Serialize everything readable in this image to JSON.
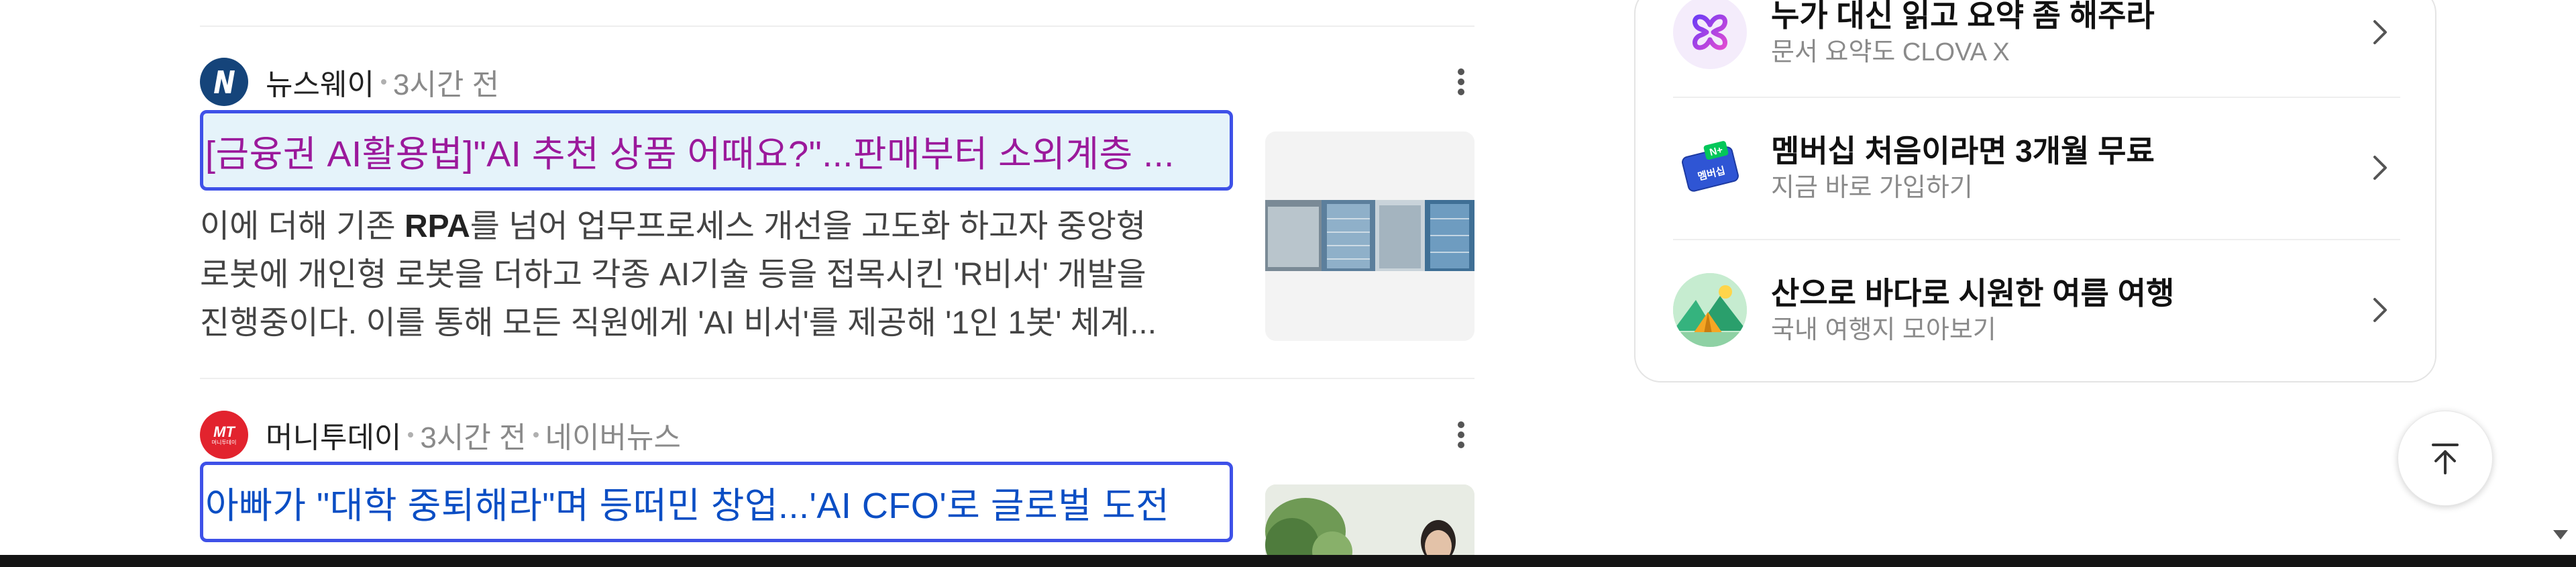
{
  "news": [
    {
      "source": "뉴스웨이",
      "time": "3시간 전",
      "extra": "",
      "headline": "[금융권 AI활용법]\"AI 추천 상품 어때요?\"...판매부터 소외계층 ...",
      "snippet_lines": [
        "이에 더해 기존 RPA를 넘어 업무프로세스 개선을 고도화 하고자 중앙형",
        "로봇에 개인형 로봇을 더하고 각종 AI기술 등을 접목시킨 'R비서' 개발을",
        "진행중이다. 이를 통해 모든 직원에게 'AI 비서'를 제공해 '1인 1봇' 체계..."
      ],
      "bold_word": "RPA"
    },
    {
      "source": "머니투데이",
      "time": "3시간 전",
      "extra": "네이버뉴스",
      "headline": "아빠가 \"대학 중퇴해라\"며 등떠민 창업...'AI CFO'로 글로벌 도전",
      "logo_text": "MT",
      "logo_subtext": "머니투데이"
    }
  ],
  "panel": {
    "items": [
      {
        "title": "누가 대신 읽고 요약 좀 해주라",
        "subtitle": "문서 요약도 CLOVA X",
        "icon": "clova-x-icon"
      },
      {
        "title": "멤버십 처음이라면 3개월 무료",
        "subtitle": "지금 바로 가입하기",
        "icon": "membership-icon",
        "icon_text_top": "N+",
        "icon_text": "멤버십"
      },
      {
        "title": "산으로 바다로 시원한 여름 여행",
        "subtitle": "국내 여행지 모아보기",
        "icon": "travel-icon"
      }
    ]
  },
  "colors": {
    "visited_link": "#9b199b",
    "link": "#0b4ec4",
    "focus_border": "#3e51e8",
    "newsway": "#15447a",
    "mt": "#e2232e"
  }
}
